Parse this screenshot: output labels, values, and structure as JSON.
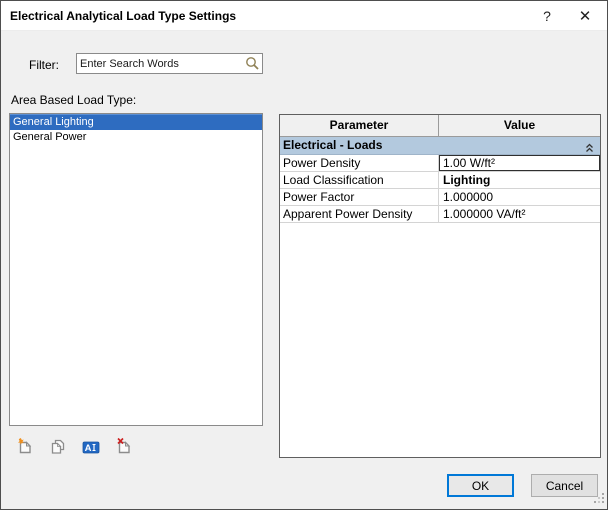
{
  "window": {
    "title": "Electrical Analytical Load Type Settings",
    "help": "?",
    "close": "✕"
  },
  "filter": {
    "label": "Filter:",
    "placeholder": "Enter Search Words",
    "icon": "search-icon"
  },
  "area_list": {
    "label": "Area Based Load Type:",
    "items": [
      {
        "label": "General Lighting",
        "selected": true
      },
      {
        "label": "General Power",
        "selected": false
      }
    ]
  },
  "toolbar": {
    "icons": [
      {
        "name": "new-load-type-icon"
      },
      {
        "name": "duplicate-load-type-icon"
      },
      {
        "name": "rename-load-type-icon"
      },
      {
        "name": "delete-load-type-icon"
      }
    ]
  },
  "properties": {
    "headers": {
      "parameter": "Parameter",
      "value": "Value"
    },
    "group": {
      "label": "Electrical - Loads",
      "collapse_icon": "collapse-chevrons-icon"
    },
    "rows": [
      {
        "parameter": "Power Density",
        "value": "1.00 W/ft²"
      },
      {
        "parameter": "Load Classification",
        "value": "Lighting"
      },
      {
        "parameter": "Power Factor",
        "value": "1.000000"
      },
      {
        "parameter": "Apparent Power Density",
        "value": "1.000000 VA/ft²"
      }
    ]
  },
  "footer": {
    "ok": "OK",
    "cancel": "Cancel"
  },
  "colors": {
    "selection_blue": "#2e6cc0",
    "group_header_blue": "#b3c9de",
    "focus_blue": "#0078d7",
    "titlebar": "#ffffff",
    "dialog_bg": "#f0f0f0"
  }
}
